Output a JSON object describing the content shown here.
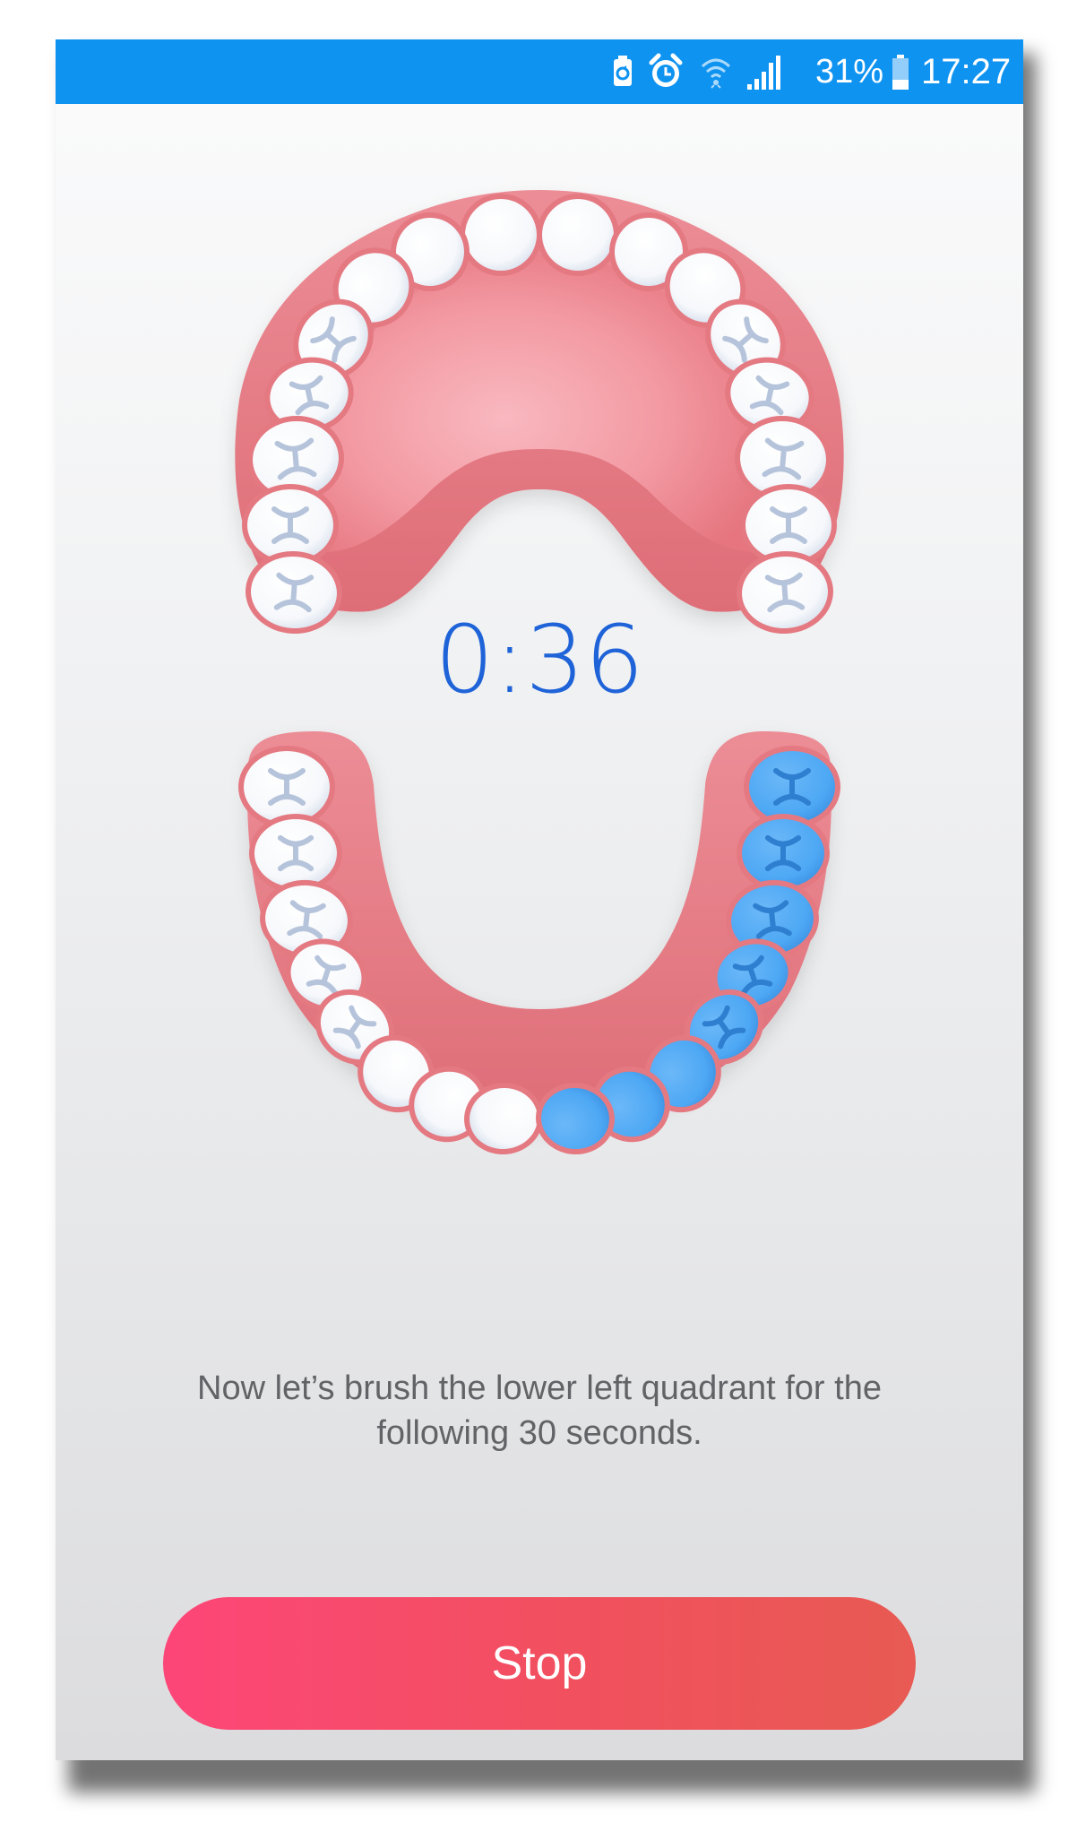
{
  "status_bar": {
    "battery_percent": "31%",
    "time": "17:27",
    "icons": [
      "recycle-battery-icon",
      "alarm-icon",
      "wifi-icon",
      "signal-icon",
      "battery-icon"
    ],
    "background_color": "#0f93f1"
  },
  "timer": {
    "value": "0:36",
    "color": "#1f63d8"
  },
  "quadrant": {
    "active": "lower-left",
    "highlight_color": "#4ea8f4"
  },
  "instruction": "Now let’s brush the lower left quadrant for the following 30 seconds.",
  "stop_button": {
    "label": "Stop",
    "gradient": [
      "#fd4678",
      "#e85a53"
    ]
  }
}
